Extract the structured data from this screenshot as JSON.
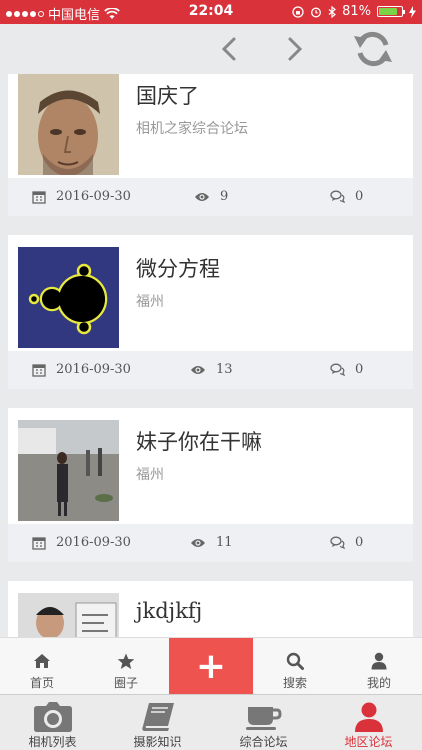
{
  "status_bar": {
    "carrier": "中国电信",
    "time": "22:04",
    "battery": "81%",
    "battery_level": 0.81
  },
  "nav": {
    "prev_icon": "chevron-left-icon",
    "next_icon": "chevron-right-icon",
    "refresh_icon": "refresh-icon"
  },
  "posts": [
    {
      "title": "国庆了",
      "subtitle": "相机之家综合论坛",
      "date": "2016-09-30",
      "views": "9",
      "comments": "0",
      "thumb": "man-portrait"
    },
    {
      "title": "微分方程",
      "subtitle": "福州",
      "date": "2016-09-30",
      "views": "13",
      "comments": "0",
      "thumb": "mandelbrot"
    },
    {
      "title": "妹子你在干嘛",
      "subtitle": "福州",
      "date": "2016-09-30",
      "views": "11",
      "comments": "0",
      "thumb": "street-scene"
    },
    {
      "title": "jkdjkfj",
      "subtitle": "",
      "date": "",
      "views": "",
      "comments": "",
      "thumb": "person-photo"
    }
  ],
  "tabbar": {
    "home": "首页",
    "circle": "圈子",
    "plus": "+",
    "search": "搜索",
    "mine": "我的"
  },
  "appnav": {
    "camera_list": "相机列表",
    "photo_knowledge": "摄影知识",
    "forum": "综合论坛",
    "region_forum": "地区论坛"
  },
  "colors": {
    "accent": "#d9323a",
    "plus_bg": "#ef5350"
  }
}
